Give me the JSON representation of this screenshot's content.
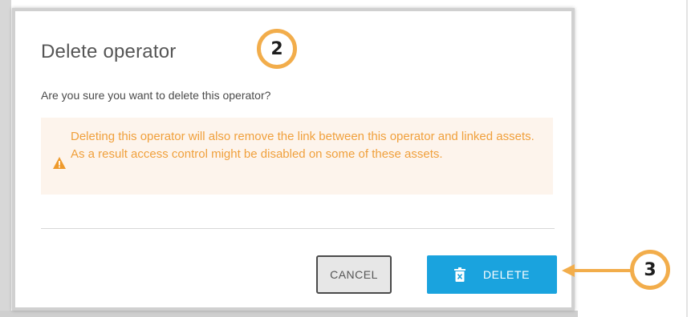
{
  "dialog": {
    "title": "Delete operator",
    "question": "Are you sure you want to delete this operator?",
    "warning": {
      "icon": "warning-triangle-icon",
      "text": "Deleting this operator will also remove the link between this operator and linked assets. As a result access control might be disabled on some of these assets."
    },
    "buttons": {
      "cancel_label": "CANCEL",
      "delete_label": "DELETE",
      "delete_icon": "trash-icon"
    }
  },
  "annotations": {
    "callout_2": "2",
    "callout_3": "3"
  },
  "colors": {
    "warning_text": "#f0a03c",
    "warning_background": "#fdf4ec",
    "delete_button": "#1aa3de",
    "callout_ring": "#f2ad4b"
  }
}
